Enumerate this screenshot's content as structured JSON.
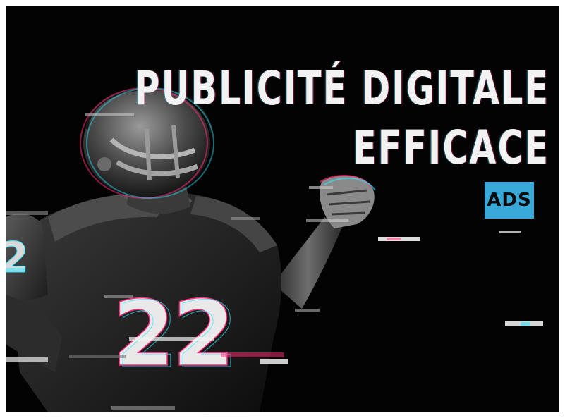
{
  "headline": {
    "line1": "PUBLICITÉ DIGITALE",
    "line2": "EFFICACE"
  },
  "badge": {
    "label": "ADS"
  },
  "jersey": {
    "chest_number": "22",
    "sleeve_number": "2"
  },
  "colors": {
    "background": "#030303",
    "headline_text": "#f2f2f2",
    "badge_background": "#38a9d9",
    "glitch_pink": "#ff2d7a",
    "glitch_cyan": "#2ee6ff"
  }
}
